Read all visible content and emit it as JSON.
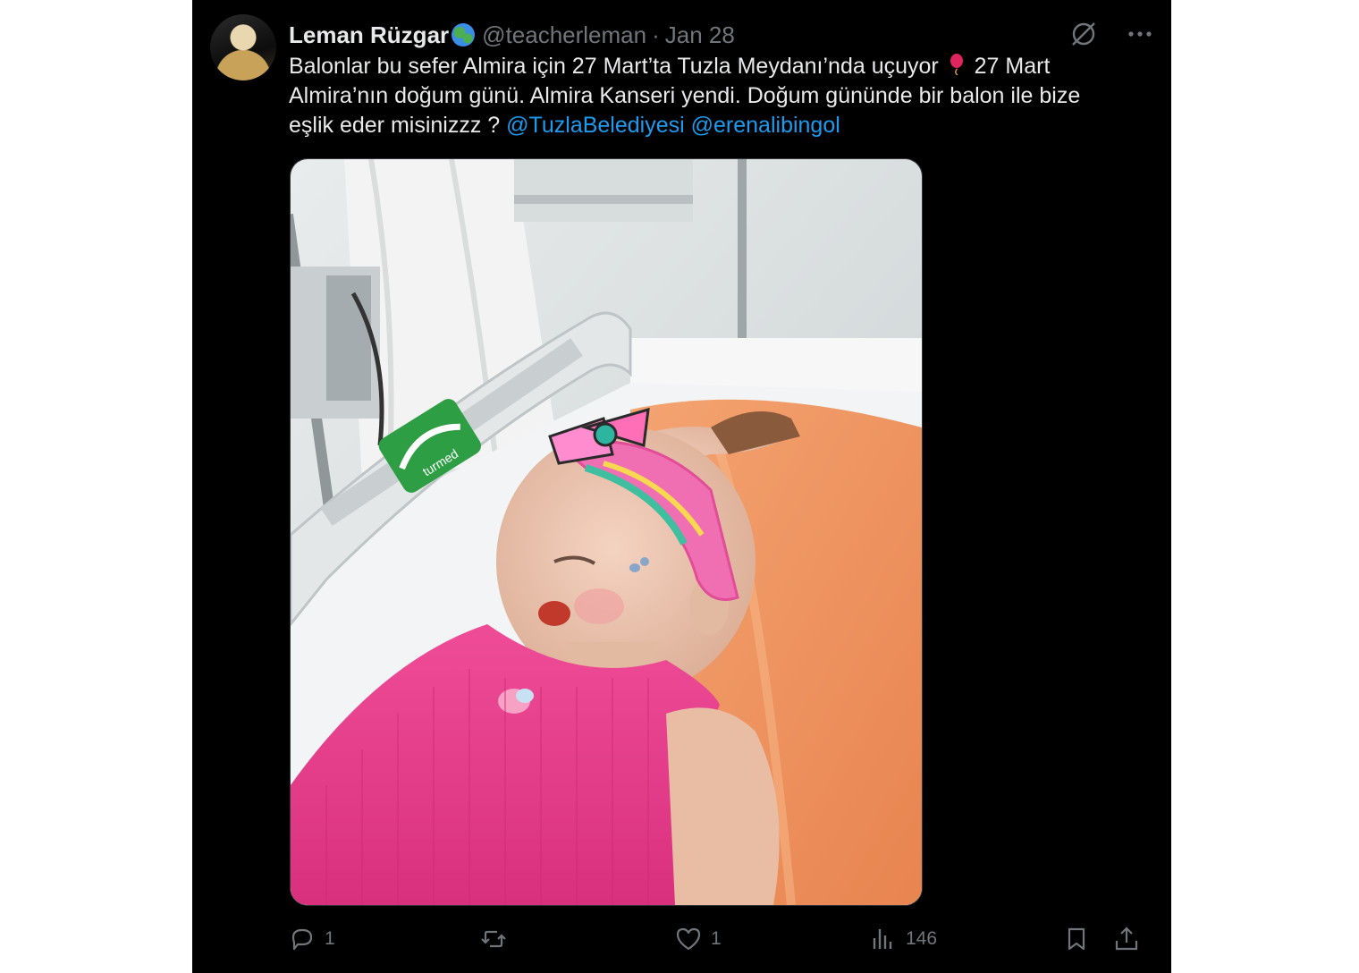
{
  "author": {
    "name": "Leman Rüzgar",
    "handle": "@teacherleman",
    "separator": "·",
    "date": "Jan 28",
    "badge_icon": "globe-icon"
  },
  "tweet": {
    "text_part1": "Balonlar bu sefer Almira için 27 Mart’ta Tuzla Meydanı’nda uçuyor",
    "text_part2": "27 Mart Almira’nın doğum günü. Almira Kanseri yendi. Doğum gününde bir balon ile bize eşlik eder misinizzz ?",
    "mention1": "@TuzlaBelediyesi",
    "mention2": "@erenalibingol",
    "emoji": "balloon-icon"
  },
  "media": {
    "bed_brand": "turmed"
  },
  "actions": {
    "replies": "1",
    "reposts": "",
    "likes": "1",
    "views": "146"
  },
  "colors": {
    "background": "#000000",
    "text": "#e7e9ea",
    "muted": "#71767b",
    "link": "#1d9bf0"
  }
}
